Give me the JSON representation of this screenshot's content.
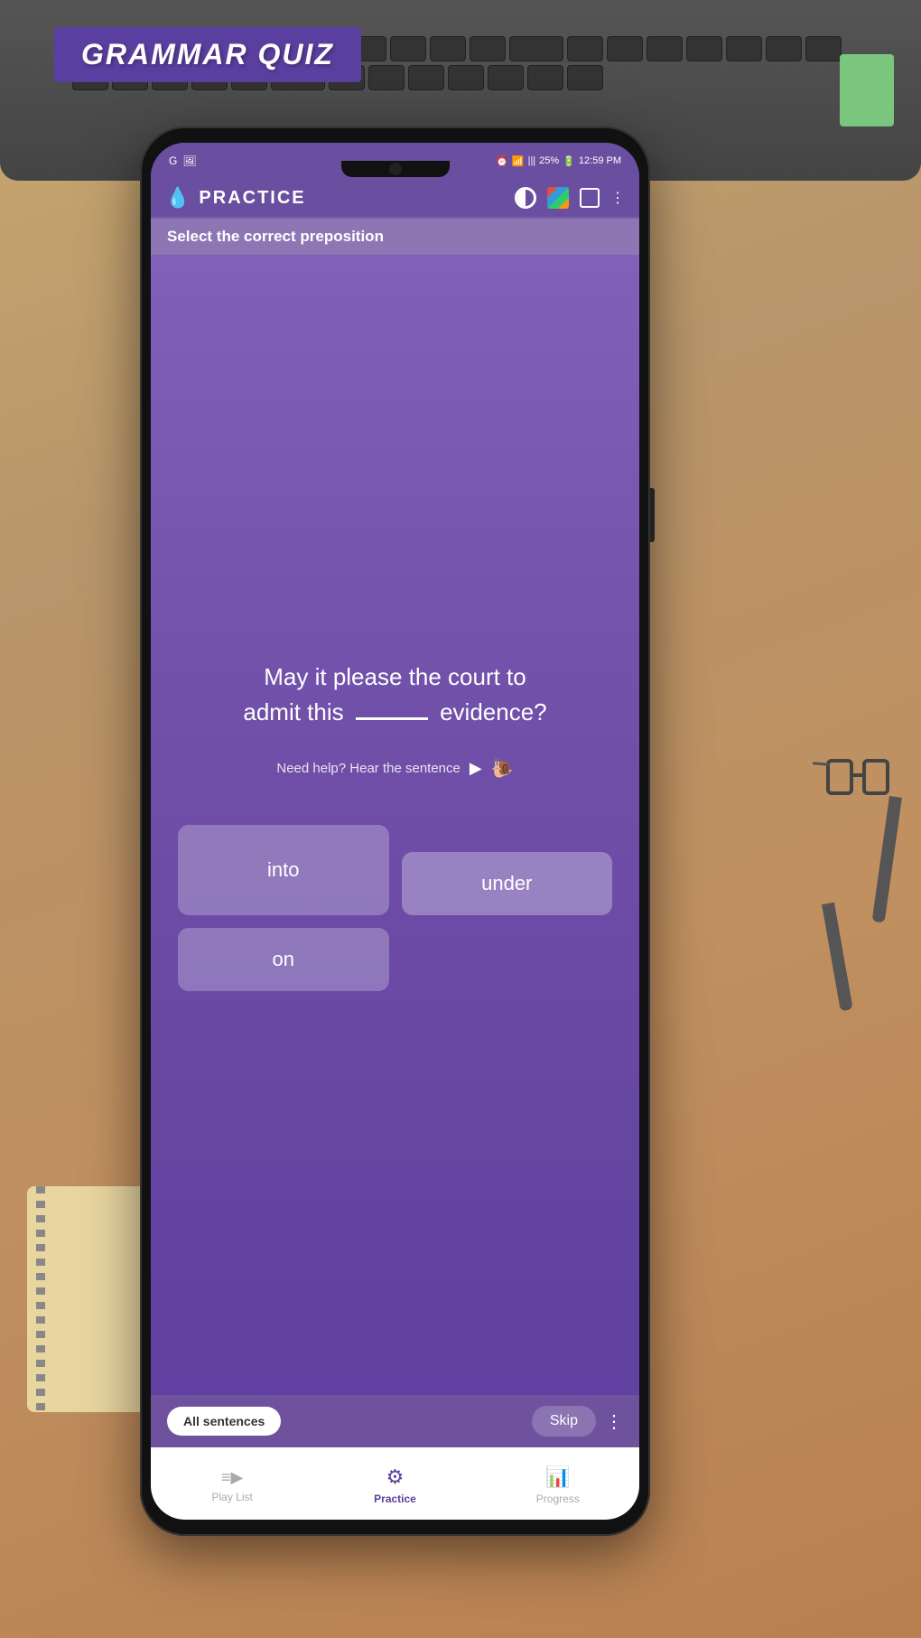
{
  "banner": {
    "text": "GRAMMAR QUIZ"
  },
  "status_bar": {
    "left_icons": [
      "G",
      "🖼"
    ],
    "time": "12:59 PM",
    "battery": "25%",
    "signal": "|||",
    "wifi": "WiFi"
  },
  "header": {
    "title": "PRACTICE",
    "drop_icon": "💧"
  },
  "question": {
    "label": "Select the correct preposition",
    "text_part1": "May it please the court to",
    "text_part2": "admit this",
    "text_part3": "evidence?",
    "blank": "______"
  },
  "hear_sentence": {
    "text": "Need help? Hear the sentence"
  },
  "answers": [
    {
      "id": "into",
      "label": "into",
      "offset": false
    },
    {
      "id": "under",
      "label": "under",
      "offset": true
    },
    {
      "id": "on",
      "label": "on",
      "offset": false
    }
  ],
  "bottom_bar": {
    "all_sentences_label": "All sentences",
    "skip_label": "Skip"
  },
  "nav": {
    "items": [
      {
        "id": "playlist",
        "label": "Play List",
        "icon": "☰",
        "active": false
      },
      {
        "id": "practice",
        "label": "Practice",
        "icon": "⚙",
        "active": true
      },
      {
        "id": "progress",
        "label": "Progress",
        "icon": "📊",
        "active": false
      }
    ]
  }
}
